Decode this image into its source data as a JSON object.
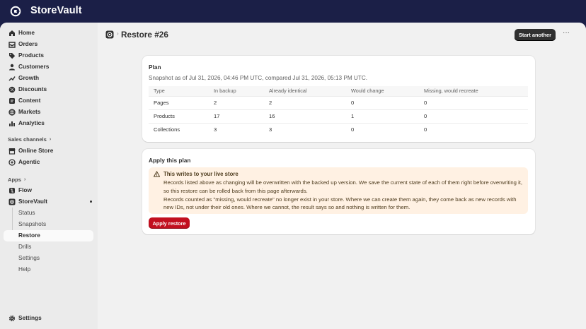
{
  "app": {
    "name": "StoreVault"
  },
  "sidebar": {
    "items": [
      {
        "label": "Home",
        "icon": "home-icon"
      },
      {
        "label": "Orders",
        "icon": "inbox-icon"
      },
      {
        "label": "Products",
        "icon": "tag-icon"
      },
      {
        "label": "Customers",
        "icon": "person-icon"
      },
      {
        "label": "Growth",
        "icon": "chart-line-icon"
      },
      {
        "label": "Discounts",
        "icon": "discount-icon"
      },
      {
        "label": "Content",
        "icon": "content-icon"
      },
      {
        "label": "Markets",
        "icon": "globe-icon"
      },
      {
        "label": "Analytics",
        "icon": "bar-chart-icon"
      }
    ],
    "sales_channels": {
      "heading": "Sales channels",
      "items": [
        {
          "label": "Online Store",
          "icon": "store-icon"
        },
        {
          "label": "Agentic",
          "icon": "sparkle-icon"
        }
      ]
    },
    "apps": {
      "heading": "Apps",
      "items": [
        {
          "label": "Flow",
          "icon": "flow-icon"
        },
        {
          "label": "StoreVault",
          "icon": "storevault-icon"
        }
      ],
      "subitems": [
        {
          "label": "Status"
        },
        {
          "label": "Snapshots"
        },
        {
          "label": "Restore",
          "active": true
        },
        {
          "label": "Drills"
        },
        {
          "label": "Settings"
        },
        {
          "label": "Help"
        }
      ]
    },
    "footer": {
      "label": "Settings",
      "icon": "gear-icon"
    }
  },
  "header": {
    "title": "Restore #26",
    "primary_action": "Start another",
    "more_label": "···"
  },
  "plan": {
    "title": "Plan",
    "snapshot_text": "Snapshot as of Jul 31, 2026, 04:46 PM UTC, compared Jul 31, 2026, 05:13 PM UTC.",
    "columns": [
      "Type",
      "In backup",
      "Already identical",
      "Would change",
      "Missing, would recreate"
    ],
    "rows": [
      [
        "Pages",
        "2",
        "2",
        "0",
        "0"
      ],
      [
        "Products",
        "17",
        "16",
        "1",
        "0"
      ],
      [
        "Collections",
        "3",
        "3",
        "0",
        "0"
      ]
    ]
  },
  "apply": {
    "title": "Apply this plan",
    "banner_title": "This writes to your live store",
    "banner_p1": "Records listed above as changing will be overwritten with the backed up version. We save the current state of each of them right before overwriting it, so this restore can be rolled back from this page afterwards.",
    "banner_p2": "Records counted as \"missing, would recreate\" no longer exist in your store. Where we can create them again, they come back as new records with new IDs, not under their old ones. Where we cannot, the result says so and nothing is written for them.",
    "button": "Apply restore"
  },
  "colors": {
    "topbar": "#1b1f47",
    "critical": "#c20f1f",
    "warning_bg": "#fff1e3"
  }
}
